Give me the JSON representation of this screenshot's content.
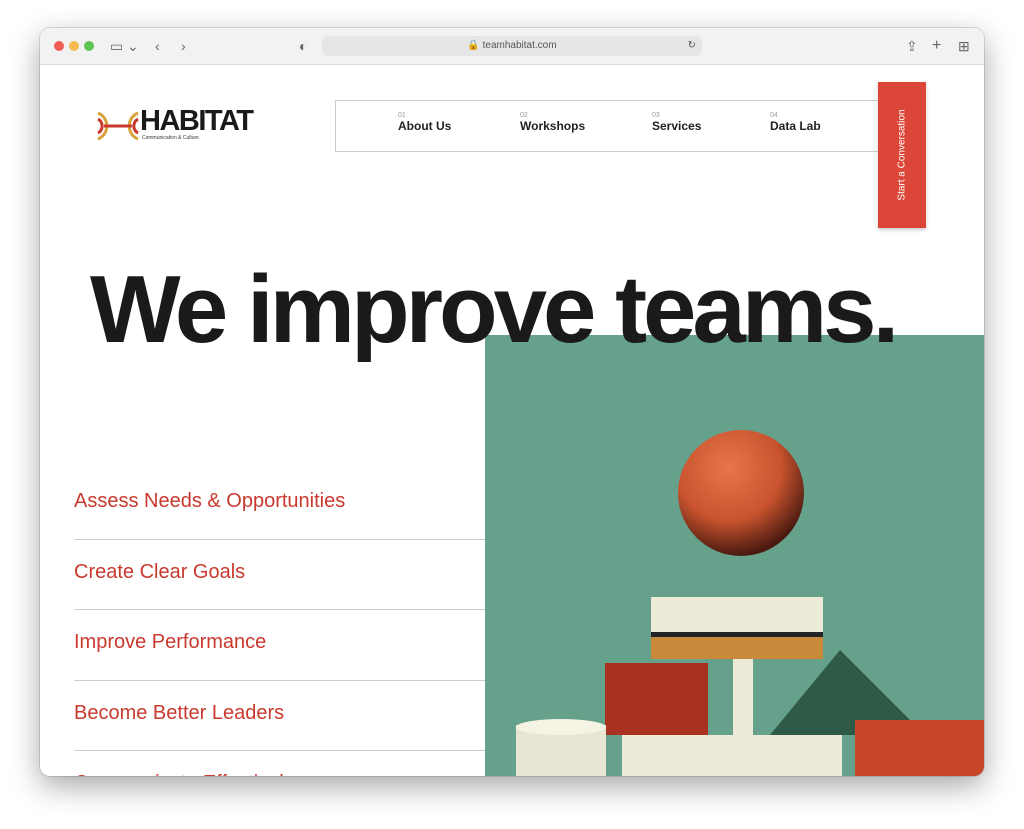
{
  "browser": {
    "url": "teamhabitat.com",
    "colors": {
      "close": "#ee5e55",
      "min": "#f5bd4f",
      "max": "#5fc453"
    }
  },
  "logo": {
    "word": "HABITAT",
    "tagline": "Communication & Culture"
  },
  "nav": [
    {
      "num": "01",
      "label": "About Us"
    },
    {
      "num": "02",
      "label": "Workshops"
    },
    {
      "num": "03",
      "label": "Services"
    },
    {
      "num": "04",
      "label": "Data Lab"
    }
  ],
  "cta": "Start a Conversation",
  "hero": "We improve teams.",
  "list": [
    "Assess Needs & Opportunities",
    "Create Clear Goals",
    "Improve Performance",
    "Become Better Leaders",
    "Communicate Effectively"
  ],
  "colors": {
    "accent": "#dc4638",
    "green": "#66a18b"
  }
}
